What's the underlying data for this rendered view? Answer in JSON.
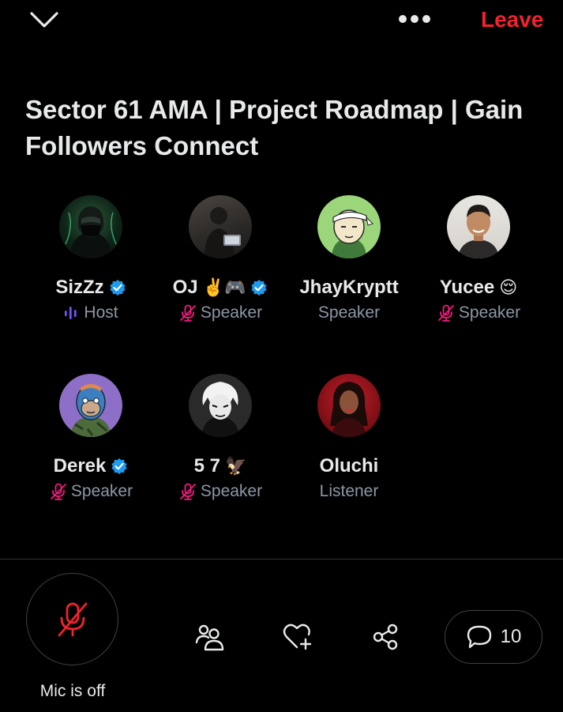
{
  "header": {
    "leave_label": "Leave",
    "leave_color": "#f4212e",
    "collapse_icon": "chevron-down-icon",
    "more_icon": "more-horizontal-icon"
  },
  "space": {
    "title": "Sector 61 AMA | Project Roadmap | Gain Followers Connect"
  },
  "participants": [
    {
      "name": "SizZz",
      "verified": true,
      "role": "Host",
      "role_icon": "host-audio-icon",
      "avatar": "masked-hooded-figure"
    },
    {
      "name": "OJ",
      "emoji": "✌️🎮",
      "verified": true,
      "role": "Speaker",
      "role_icon": "mic-muted-icon",
      "avatar": "person-with-laptop"
    },
    {
      "name": "JhayKryptt",
      "verified": false,
      "role": "Speaker",
      "role_icon": "",
      "avatar": "anime-character-headband"
    },
    {
      "name": "Yucee",
      "emoji": "😌",
      "verified": false,
      "role": "Speaker",
      "role_icon": "mic-muted-icon",
      "avatar": "smiling-man"
    },
    {
      "name": "Derek",
      "verified": true,
      "role": "Speaker",
      "role_icon": "mic-muted-icon",
      "avatar": "blue-ape"
    },
    {
      "name": "5 7",
      "emoji": "🦅",
      "verified": false,
      "role": "Speaker",
      "role_icon": "mic-muted-icon",
      "avatar": "anime-white-hair"
    },
    {
      "name": "Oluchi",
      "verified": false,
      "role": "Listener",
      "role_icon": "",
      "avatar": "woman-red-background"
    }
  ],
  "controls": {
    "mic_label": "Mic is off",
    "comments_count": "10",
    "mic_off_color": "#f4212e"
  }
}
